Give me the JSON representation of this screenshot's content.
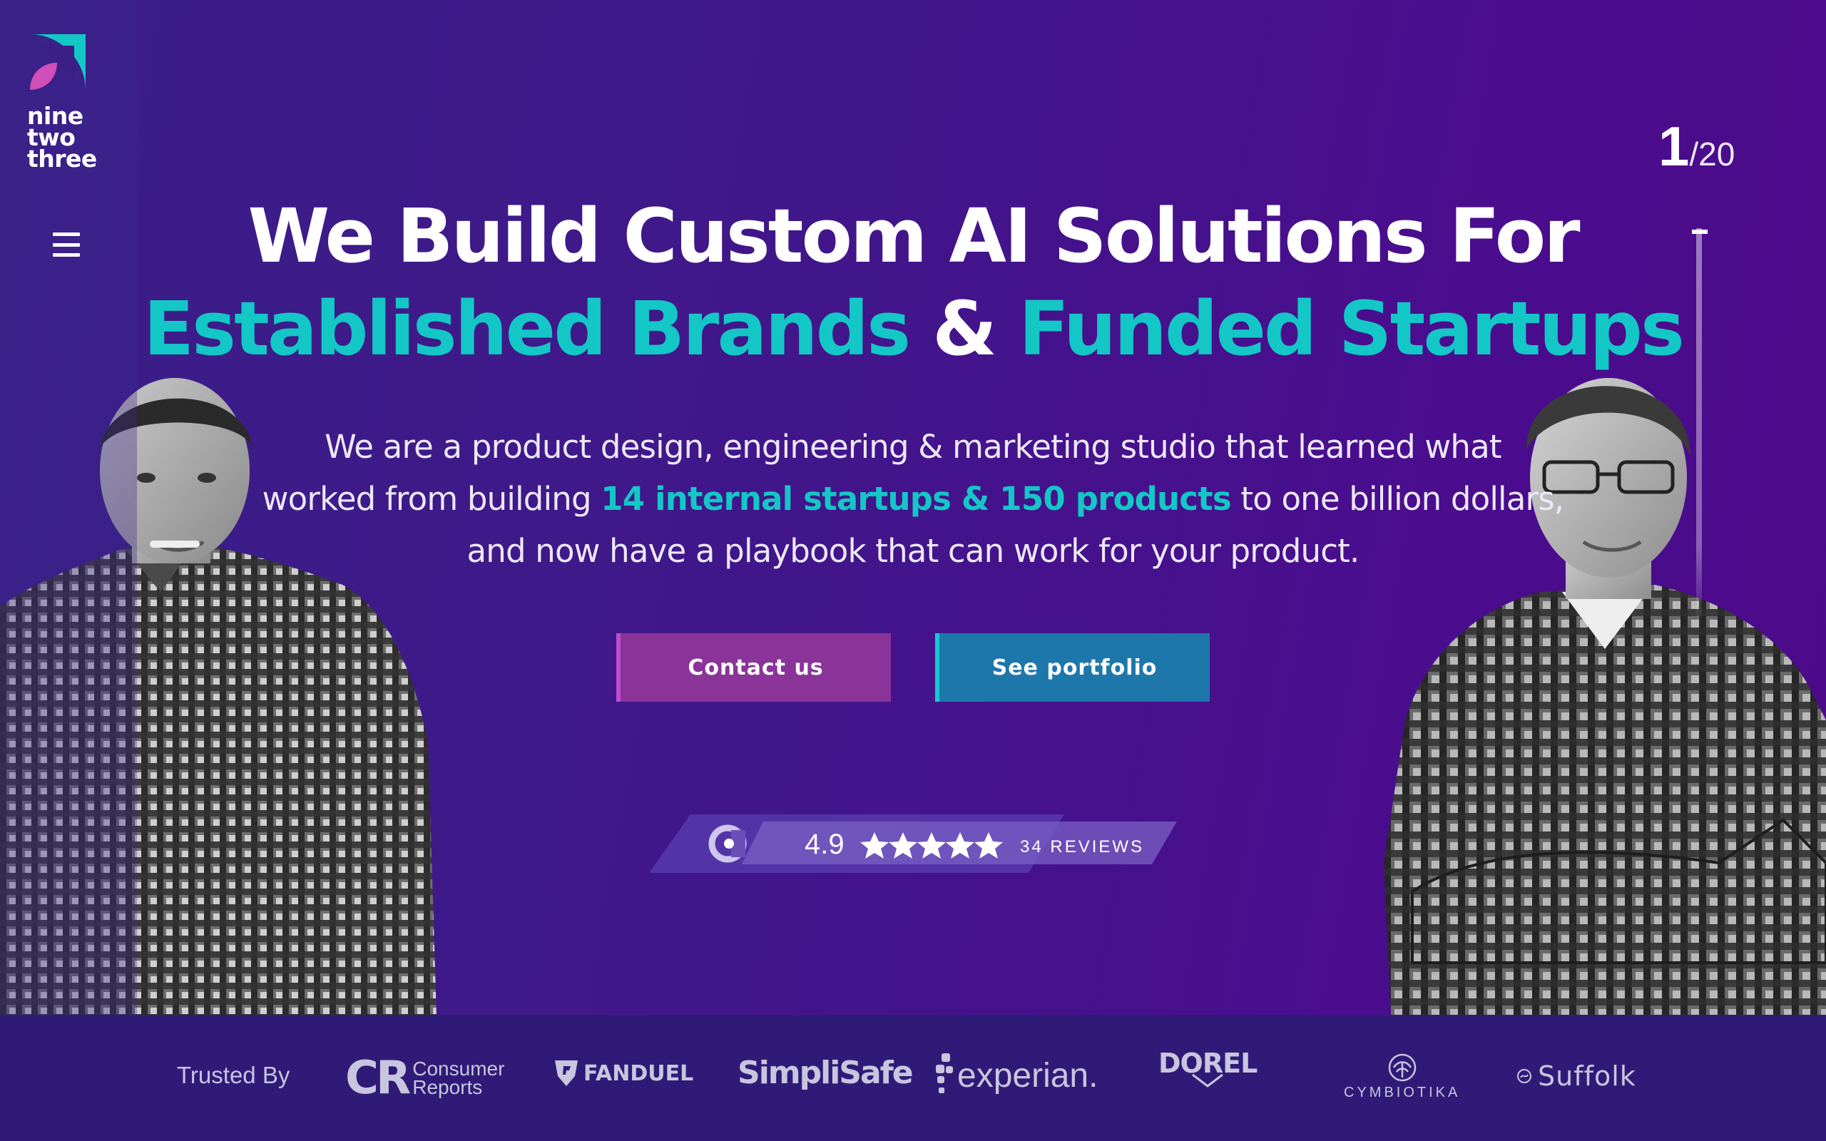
{
  "brand": {
    "logo_lines": [
      "nine",
      "two",
      "three"
    ]
  },
  "nav": {
    "menu_icon": "hamburger-menu-icon"
  },
  "slider": {
    "current": "1",
    "total": "/20",
    "progress_fraction": 0.05
  },
  "hero": {
    "headline_line1": "We Build Custom AI Solutions For",
    "headline_accent1": "Established Brands",
    "headline_amp": " & ",
    "headline_accent2": "Funded Startups",
    "sub_line1": "We are a product design, engineering & marketing studio that learned what",
    "sub_line2_pre": "worked from building ",
    "sub_line2_hl": "14 internal startups & 150 products",
    "sub_line2_post": " to one billion dollars,",
    "sub_line3": "and now have a playbook that can work for your product."
  },
  "cta": {
    "contact_label": "Contact us",
    "portfolio_label": "See portfolio"
  },
  "rating": {
    "score": "4.9",
    "stars": 4.9,
    "reviews": "34 REVIEWS",
    "icon": "clutch-logo-icon"
  },
  "trusted": {
    "label": "Trusted By",
    "clients": [
      {
        "name": "CR",
        "sub1": "Consumer",
        "sub2": "Reports"
      },
      {
        "name": "FANDUEL"
      },
      {
        "name": "SimpliSafe"
      },
      {
        "name": "experian."
      },
      {
        "name": "DOREL"
      },
      {
        "name": "CYMBIOTIKA"
      },
      {
        "name": "Suffolk"
      }
    ]
  },
  "colors": {
    "accent_teal": "#14c7c7",
    "contact_btn": "#8a3499",
    "portfolio_btn": "#1e77ab",
    "bg_purple": "#40178a",
    "trusted_bar": "#2f1b77"
  }
}
